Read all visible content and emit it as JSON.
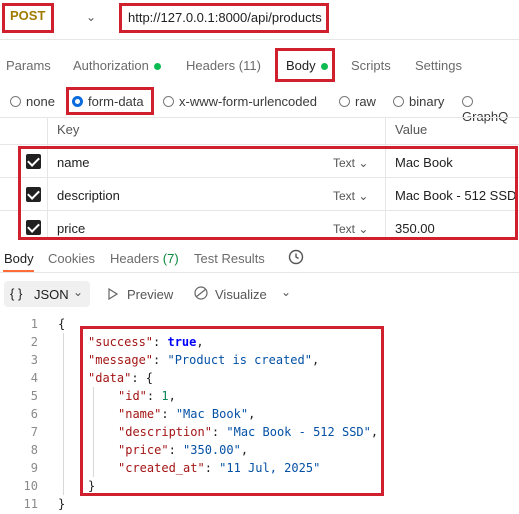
{
  "request": {
    "method": "POST",
    "url": "http://127.0.0.1:8000/api/products"
  },
  "req_tabs": [
    {
      "label": "Params"
    },
    {
      "label": "Authorization"
    },
    {
      "label": "Headers",
      "count": "(11)"
    },
    {
      "label": "Body"
    },
    {
      "label": "Scripts"
    },
    {
      "label": "Settings"
    }
  ],
  "body_types": [
    "none",
    "form-data",
    "x-www-form-urlencoded",
    "raw",
    "binary",
    "GraphQ"
  ],
  "form_table": {
    "headers": {
      "key": "Key",
      "value": "Value"
    },
    "rows": [
      {
        "key": "name",
        "type": "Text",
        "value": "Mac Book"
      },
      {
        "key": "description",
        "type": "Text",
        "value": "Mac Book - 512 SSD"
      },
      {
        "key": "price",
        "type": "Text",
        "value": "350.00"
      }
    ]
  },
  "resp_tabs": [
    {
      "label": "Body"
    },
    {
      "label": "Cookies"
    },
    {
      "label": "Headers",
      "count": "(7)"
    },
    {
      "label": "Test Results"
    }
  ],
  "resp_toolbar": {
    "format": "JSON",
    "preview": "Preview",
    "visualize": "Visualize"
  },
  "code": {
    "line_numbers": [
      "1",
      "2",
      "3",
      "4",
      "5",
      "6",
      "7",
      "8",
      "9",
      "10",
      "11"
    ],
    "l1": "{",
    "l2_key": "\"success\"",
    "l2_val": "true",
    "l3_key": "\"message\"",
    "l3_val": "\"Product is created\"",
    "l4_key": "\"data\"",
    "l4_rest": ": {",
    "l5_key": "\"id\"",
    "l5_val": "1",
    "l6_key": "\"name\"",
    "l6_val": "\"Mac Book\"",
    "l7_key": "\"description\"",
    "l7_val": "\"Mac Book - 512 SSD\"",
    "l8_key": "\"price\"",
    "l8_val": "\"350.00\"",
    "l9_key": "\"created_at\"",
    "l9_val": "\"11 Jul, 2025\"",
    "l10": "}",
    "l11": "}"
  },
  "colors": {
    "highlight_box": "#d0202e",
    "active_tab_underline": "#ff6c37",
    "status_dot": "#0cbb52",
    "method": "#a07b00"
  },
  "icons": [
    "chevron-down-icon",
    "play-icon",
    "visualize-icon",
    "history-icon",
    "braces-icon"
  ]
}
